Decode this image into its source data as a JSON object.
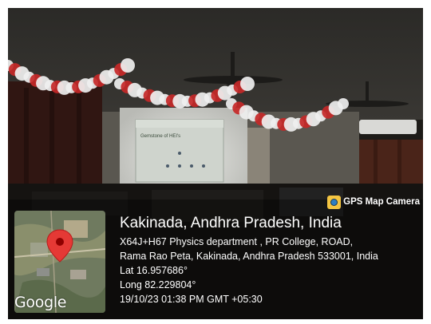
{
  "camera_badge": {
    "label": "GPS Map Camera"
  },
  "map": {
    "brand": "Google"
  },
  "slide": {
    "heading": "Gemstone of HEI's"
  },
  "location": {
    "city": "Kakinada, Andhra Pradesh, India",
    "address_line1": "X64J+H67 Physics department , PR College, ROAD,",
    "address_line2": "Rama Rao Peta, Kakinada, Andhra Pradesh 533001, India",
    "latitude": "Lat 16.957686°",
    "longitude": "Long 82.229804°",
    "timestamp": "19/10/23 01:38 PM GMT +05:30"
  },
  "colors": {
    "pin": "#e53935",
    "balloon_red": "#c62828",
    "balloon_white": "#efefef",
    "badge_icon": "#f4c542"
  }
}
